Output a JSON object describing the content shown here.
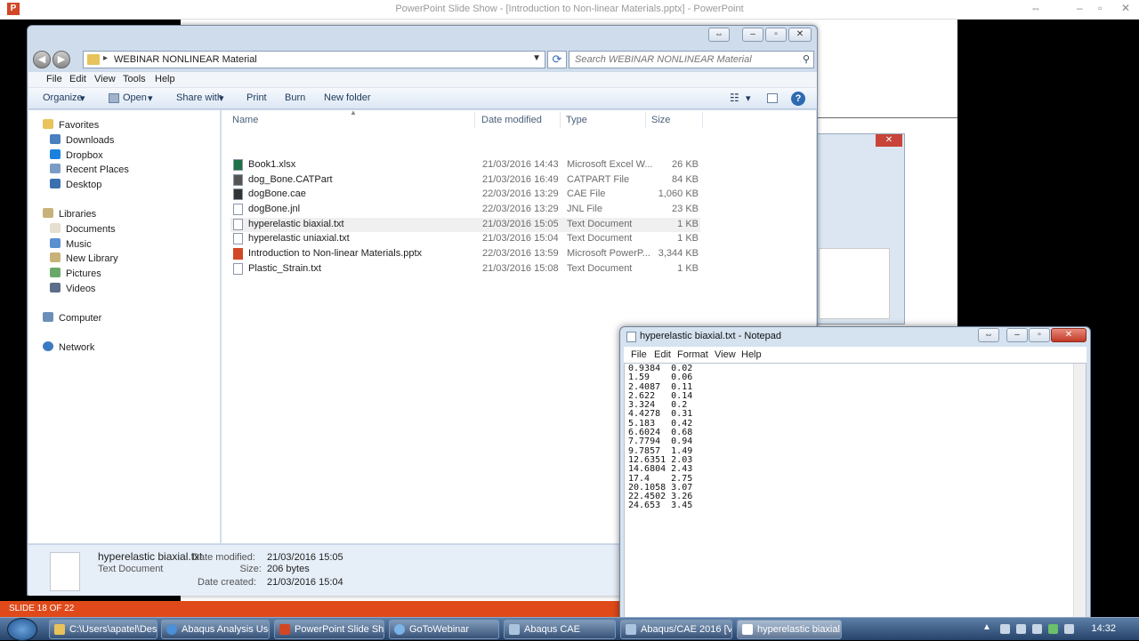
{
  "powerpoint": {
    "title": "PowerPoint Slide Show - [Introduction to Non-linear Materials.pptx] - PowerPoint",
    "footer": "SLIDE 18 OF 22"
  },
  "explorer": {
    "address_path": "WEBINAR NONLINEAR Material",
    "search_placeholder": "Search WEBINAR NONLINEAR Material",
    "menu": [
      "File",
      "Edit",
      "View",
      "Tools",
      "Help"
    ],
    "toolbar": {
      "organize": "Organize",
      "open": "Open",
      "share_with": "Share with",
      "print": "Print",
      "burn": "Burn",
      "new_folder": "New folder"
    },
    "sidebar": {
      "favorites_header": "Favorites",
      "favorites": [
        "Downloads",
        "Dropbox",
        "Recent Places",
        "Desktop"
      ],
      "libraries_header": "Libraries",
      "libraries": [
        "Documents",
        "Music",
        "New Library",
        "Pictures",
        "Videos"
      ],
      "computer": "Computer",
      "network": "Network"
    },
    "columns": {
      "name": "Name",
      "date": "Date modified",
      "type": "Type",
      "size": "Size"
    },
    "files": [
      {
        "name": "Book1.xlsx",
        "date": "21/03/2016 14:43",
        "type": "Microsoft Excel W...",
        "size": "26 KB",
        "color": "#1e7145"
      },
      {
        "name": "dog_Bone.CATPart",
        "date": "21/03/2016 16:49",
        "type": "CATPART File",
        "size": "84 KB",
        "color": "#555555"
      },
      {
        "name": "dogBone.cae",
        "date": "22/03/2016 13:29",
        "type": "CAE File",
        "size": "1,060 KB",
        "color": "#333333"
      },
      {
        "name": "dogBone.jnl",
        "date": "22/03/2016 13:29",
        "type": "JNL File",
        "size": "23 KB",
        "color": "#ffffff"
      },
      {
        "name": "hyperelastic biaxial.txt",
        "date": "21/03/2016 15:05",
        "type": "Text Document",
        "size": "1 KB",
        "color": "#ffffff"
      },
      {
        "name": "hyperelastic uniaxial.txt",
        "date": "21/03/2016 15:04",
        "type": "Text Document",
        "size": "1 KB",
        "color": "#ffffff"
      },
      {
        "name": "Introduction to Non-linear Materials.pptx",
        "date": "22/03/2016 13:59",
        "type": "Microsoft PowerP...",
        "size": "3,344 KB",
        "color": "#d24726"
      },
      {
        "name": "Plastic_Strain.txt",
        "date": "21/03/2016 15:08",
        "type": "Text Document",
        "size": "1 KB",
        "color": "#ffffff"
      }
    ],
    "details": {
      "file_name": "hyperelastic biaxial.txt",
      "file_type": "Text Document",
      "modified_label": "Date modified:",
      "modified_value": "21/03/2016 15:05",
      "size_label": "Size:",
      "size_value": "206 bytes",
      "created_label": "Date created:",
      "created_value": "21/03/2016 15:04"
    }
  },
  "notepad": {
    "title": "hyperelastic biaxial.txt - Notepad",
    "menu": [
      "File",
      "Edit",
      "Format",
      "View",
      "Help"
    ],
    "lines": [
      "0.9384  0.02",
      "1.59    0.06",
      "2.4087  0.11",
      "2.622   0.14",
      "3.324   0.2",
      "4.4278  0.31",
      "5.183   0.42",
      "6.6024  0.68",
      "7.7794  0.94",
      "9.7857  1.49",
      "12.6351 2.03",
      "14.6804 2.43",
      "17.4    2.75",
      "20.1058 3.07",
      "22.4502 3.26",
      "24.653  3.45"
    ]
  },
  "taskbar": {
    "items": [
      {
        "label": "C:\\Users\\apatel\\Desk...",
        "color": "#e8c25a"
      },
      {
        "label": "Abaqus Analysis Use...",
        "color": "#4a8fd8"
      },
      {
        "label": "PowerPoint Slide Sh...",
        "color": "#d24726"
      },
      {
        "label": "GoToWebinar",
        "color": "#7cb4e8"
      },
      {
        "label": "Abaqus CAE",
        "color": "#aac4e0"
      },
      {
        "label": "Abaqus/CAE 2016 [Vi...",
        "color": "#aac4e0"
      },
      {
        "label": "hyperelastic biaxial.tx...",
        "color": "#ffffff"
      }
    ],
    "clock": "14:32"
  }
}
